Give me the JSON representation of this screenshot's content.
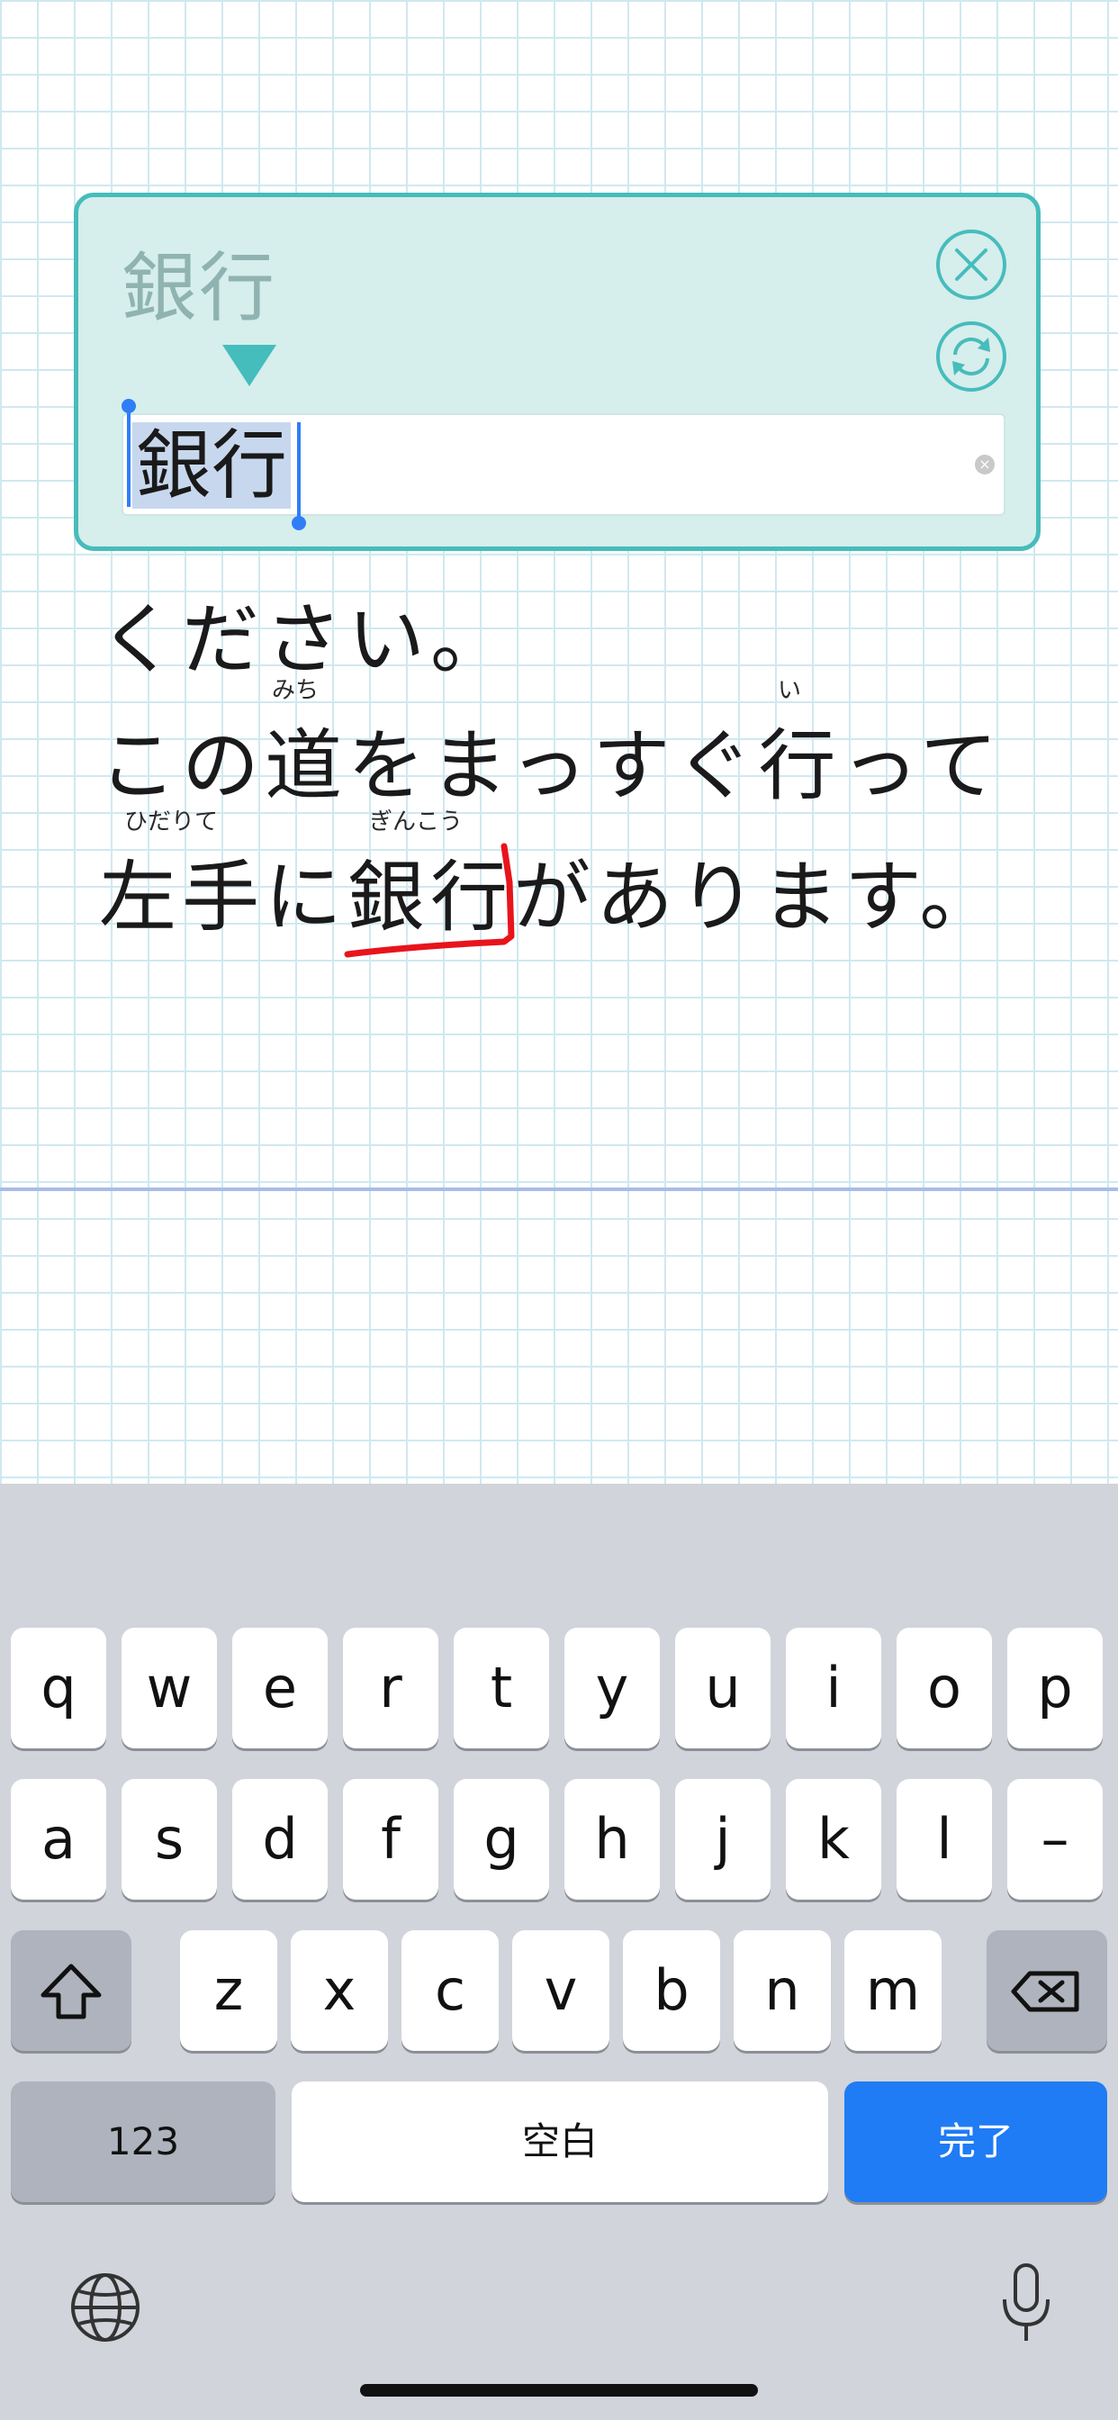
{
  "edit_panel": {
    "source_text": "銀行",
    "input_value": "銀行",
    "close_icon": "close-icon",
    "refresh_icon": "refresh-icon"
  },
  "text_lines": [
    {
      "text": "ください。"
    },
    {
      "text": "この道をまっすぐ行って",
      "ruby": [
        "みち",
        "い"
      ]
    },
    {
      "text": "左手に銀行があります。",
      "ruby": [
        "ひだりて",
        "ぎんこう"
      ]
    }
  ],
  "keyboard": {
    "row1": [
      "q",
      "w",
      "e",
      "r",
      "t",
      "y",
      "u",
      "i",
      "o",
      "p"
    ],
    "row2": [
      "a",
      "s",
      "d",
      "f",
      "g",
      "h",
      "j",
      "k",
      "l",
      "–"
    ],
    "row3": [
      "z",
      "x",
      "c",
      "v",
      "b",
      "n",
      "m"
    ],
    "numbers_label": "123",
    "space_label": "空白",
    "done_label": "完了",
    "shift_icon": "shift-icon",
    "delete_icon": "delete-icon",
    "globe_icon": "globe-icon",
    "mic_icon": "mic-icon",
    "done_color": "#1f7cf5"
  },
  "colors": {
    "panel_bg": "#d6eeec",
    "panel_border": "#47bcbc",
    "annotation_stroke": "#e8141b"
  }
}
